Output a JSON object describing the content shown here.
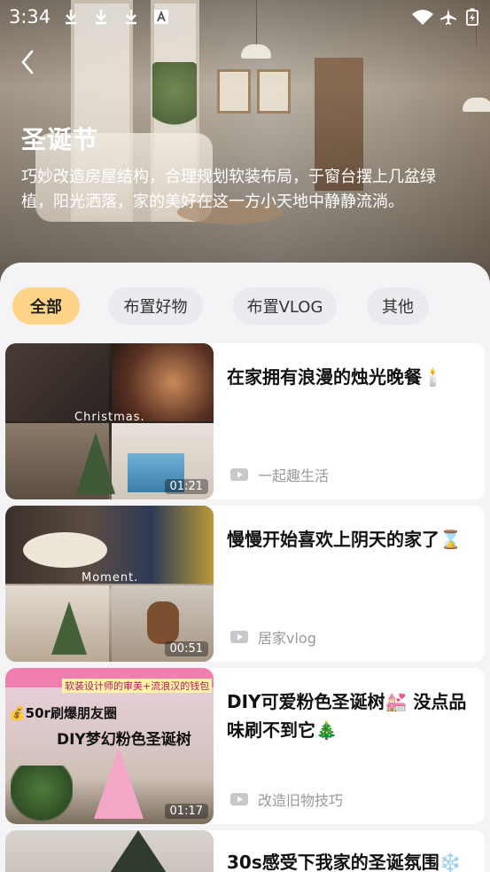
{
  "status_bar": {
    "time": "3:34"
  },
  "hero": {
    "title": "圣诞节",
    "description": "巧妙改造房屋结构，合理规划软装布局，于窗台摆上几盆绿植，阳光洒落，家的美好在这一方小天地中静静流淌。"
  },
  "tabs": [
    {
      "label": "全部",
      "active": true
    },
    {
      "label": "布置好物",
      "active": false
    },
    {
      "label": "布置VLOG",
      "active": false
    },
    {
      "label": "其他",
      "active": false
    }
  ],
  "videos": [
    {
      "title": "在家拥有浪漫的烛光晚餐🕯️",
      "author": "一起趣生活",
      "duration": "01:21",
      "overlay": "Christmas."
    },
    {
      "title": "慢慢开始喜欢上阴天的家了⌛",
      "author": "居家vlog",
      "duration": "00:51",
      "overlay": "Moment."
    },
    {
      "title": "DIY可爱粉色圣诞树💒 没点品味刷不到它🎄",
      "author": "改造旧物技巧",
      "duration": "01:17",
      "overlay_top": "软装设计师的审美+流浪汉的钱包",
      "overlay_line1": "💰50r刷爆朋友圈",
      "overlay_line2": "DIY梦幻粉色圣诞树"
    },
    {
      "title": "30s感受下我家的圣诞氛围❄️",
      "author": "",
      "duration": ""
    }
  ],
  "colors": {
    "active_tab": "#ffd489",
    "tab_bg": "#ebebef",
    "page_bg": "#f4f4f6"
  }
}
